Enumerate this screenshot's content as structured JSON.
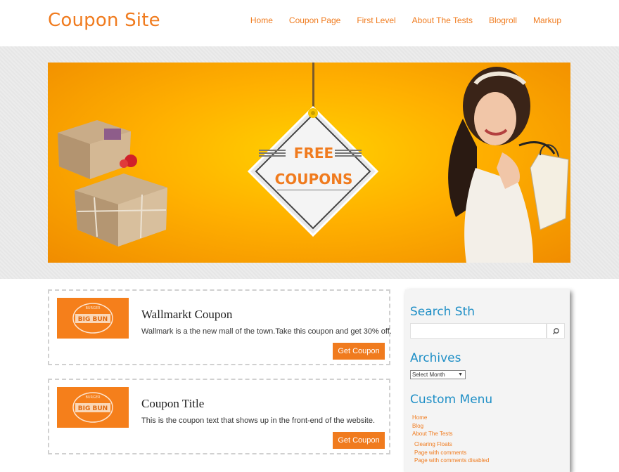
{
  "site": {
    "title": "Coupon Site"
  },
  "nav": [
    "Home",
    "Coupon Page",
    "First Level",
    "About The Tests",
    "Blogroll",
    "Markup"
  ],
  "banner": {
    "line1": "FREE",
    "line2": "COUPONS"
  },
  "coupons": [
    {
      "image_text": "BIG BUN",
      "image_subtext": "BURGER",
      "title": "Wallmarkt Coupon",
      "text": "Wallmark is a the new mall of the town.Take this coupon and get 30% off.",
      "button": "Get Coupon"
    },
    {
      "image_text": "BIG BUN",
      "image_subtext": "BURGER",
      "title": "Coupon Title",
      "text": "This is the coupon text that shows up in the front-end of the website.",
      "button": "Get Coupon"
    }
  ],
  "sidebar": {
    "search_title": "Search Sth",
    "search_placeholder": "",
    "archives_title": "Archives",
    "archives_select": "Select Month",
    "custom_menu_title": "Custom Menu",
    "menu": [
      "Home",
      "Blog",
      "About The Tests"
    ],
    "submenu": [
      "Clearing Floats",
      "Page with comments",
      "Page with comments disabled"
    ]
  },
  "colors": {
    "accent": "#f07b1e",
    "widget_title": "#1f8fc6"
  }
}
